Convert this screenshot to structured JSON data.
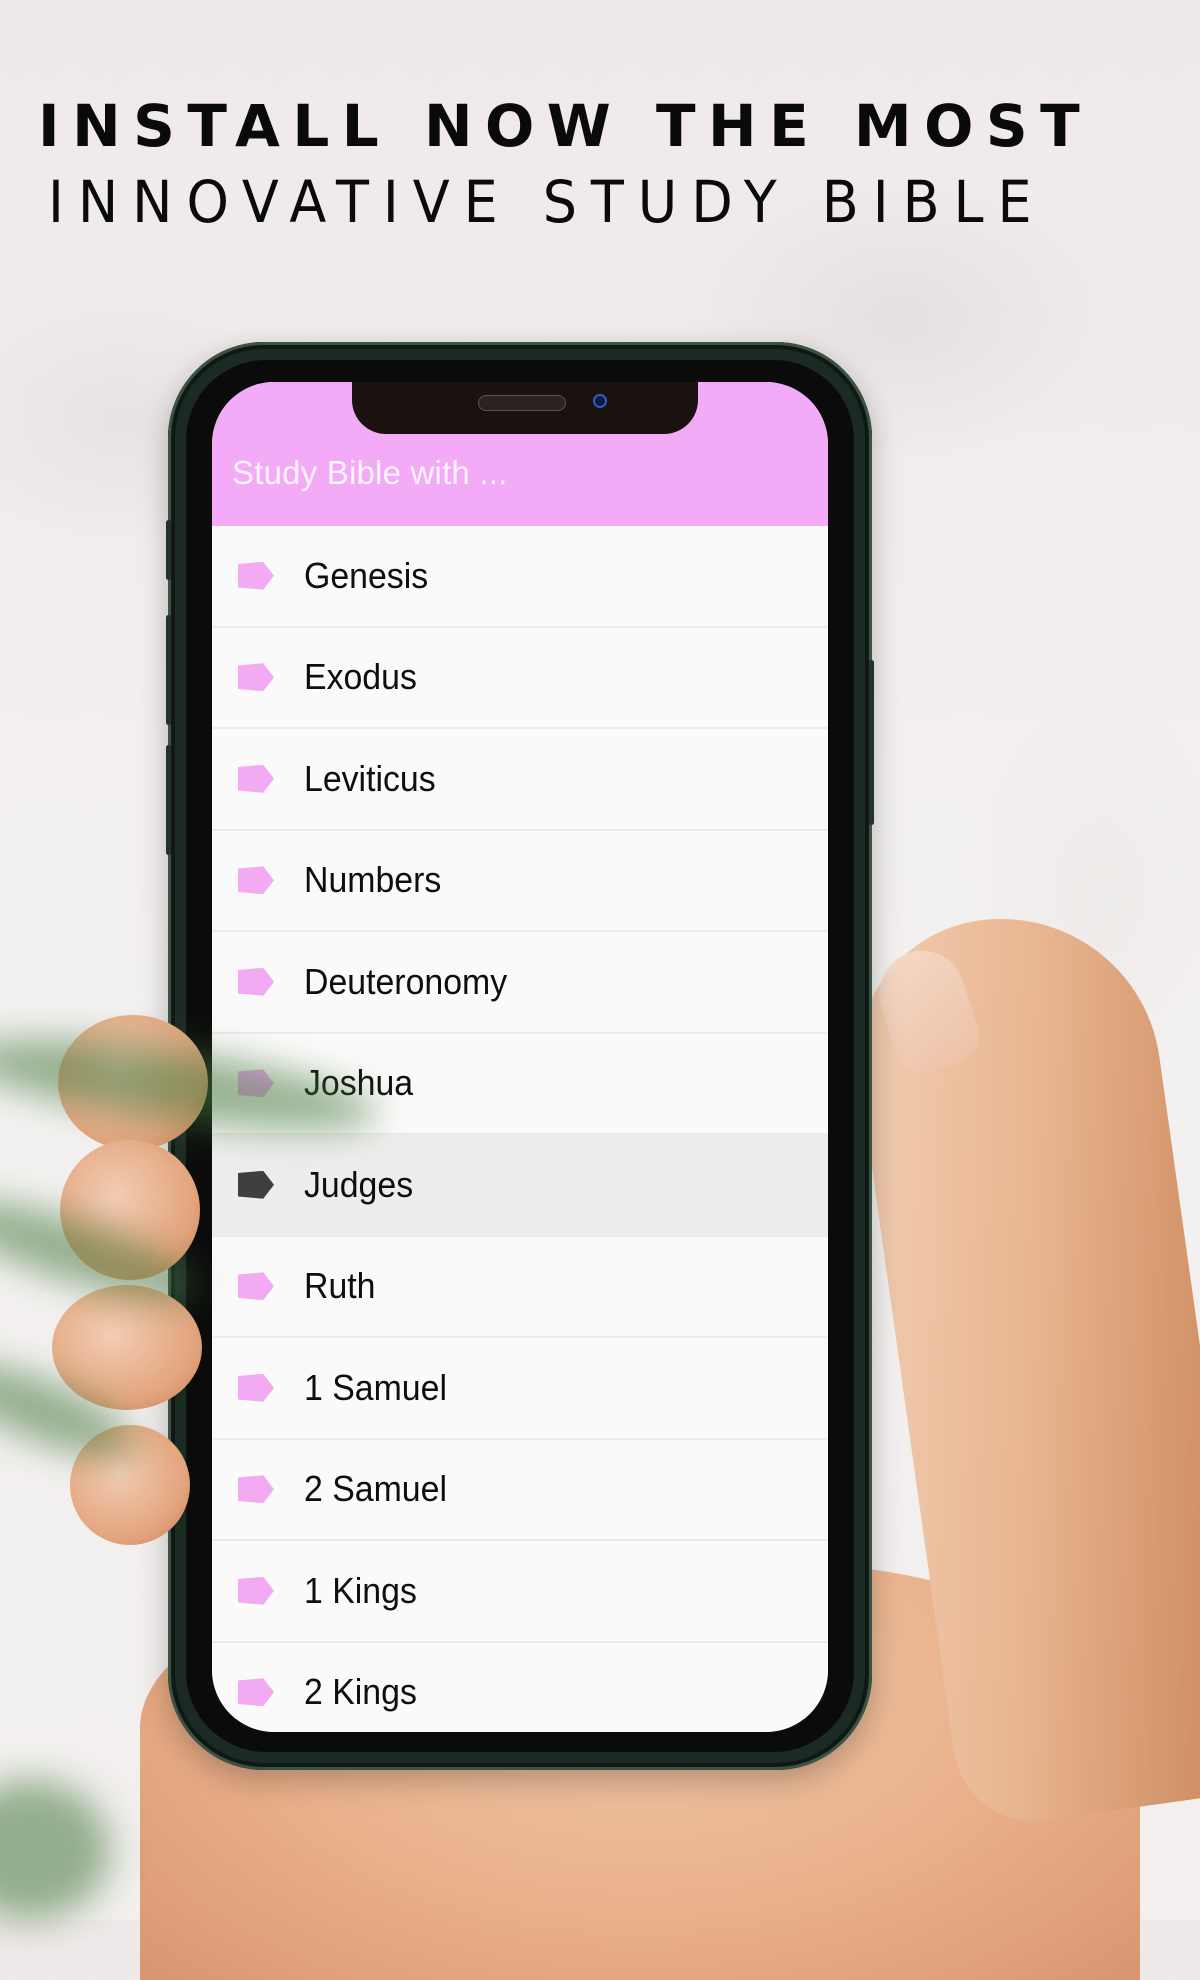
{
  "promo": {
    "headline_line1": "INSTALL NOW THE MOST",
    "headline_line2": "INNOVATIVE STUDY BIBLE"
  },
  "app": {
    "title": "Study Bible with ...",
    "accent_color": "#f3aaf7",
    "selected_icon_color": "#3f3f3f"
  },
  "books": {
    "items": [
      {
        "label": "Genesis",
        "icon": "tag-icon",
        "selected": false
      },
      {
        "label": "Exodus",
        "icon": "tag-icon",
        "selected": false
      },
      {
        "label": "Leviticus",
        "icon": "tag-icon",
        "selected": false
      },
      {
        "label": "Numbers",
        "icon": "tag-icon",
        "selected": false
      },
      {
        "label": "Deuteronomy",
        "icon": "tag-icon",
        "selected": false
      },
      {
        "label": "Joshua",
        "icon": "tag-icon",
        "selected": false
      },
      {
        "label": "Judges",
        "icon": "tag-icon",
        "selected": true
      },
      {
        "label": "Ruth",
        "icon": "tag-icon",
        "selected": false
      },
      {
        "label": "1 Samuel",
        "icon": "tag-icon",
        "selected": false
      },
      {
        "label": "2 Samuel",
        "icon": "tag-icon",
        "selected": false
      },
      {
        "label": "1 Kings",
        "icon": "tag-icon",
        "selected": false
      },
      {
        "label": "2 Kings",
        "icon": "tag-icon",
        "selected": false
      }
    ]
  }
}
